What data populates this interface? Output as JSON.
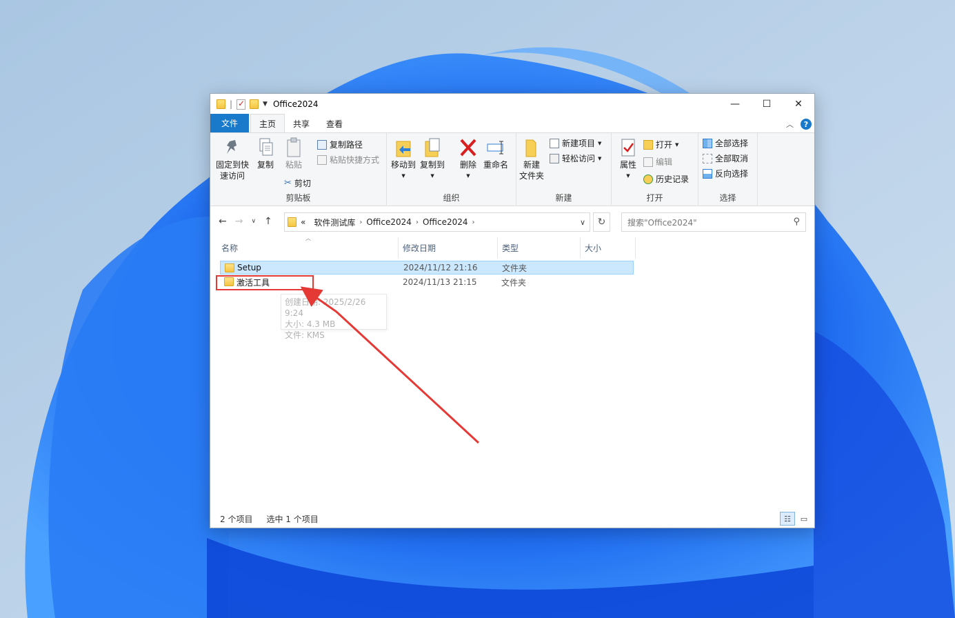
{
  "colors": {
    "accent": "#1979ca",
    "highlight": "#e53935",
    "selection": "#cce8ff"
  },
  "window": {
    "title": "Office2024",
    "controls": {
      "minimize": "—",
      "maximize": "☐",
      "close": "✕"
    }
  },
  "tabs": {
    "file": "文件",
    "home": "主页",
    "share": "共享",
    "view": "查看"
  },
  "ribbon": {
    "clipboard": {
      "label": "剪贴板",
      "pin_line1": "固定到快",
      "pin_line2": "速访问",
      "copy": "复制",
      "paste": "粘贴",
      "copy_path": "复制路径",
      "paste_shortcut": "粘贴快捷方式",
      "cut": "剪切"
    },
    "organize": {
      "label": "组织",
      "move_to": "移动到",
      "copy_to": "复制到",
      "delete": "删除",
      "rename": "重命名"
    },
    "new": {
      "label": "新建",
      "new_folder_line1": "新建",
      "new_folder_line2": "文件夹",
      "new_item": "新建项目",
      "easy_access": "轻松访问"
    },
    "open": {
      "label": "打开",
      "properties": "属性",
      "open": "打开",
      "edit": "编辑",
      "history": "历史记录"
    },
    "select": {
      "label": "选择",
      "select_all": "全部选择",
      "select_none": "全部取消",
      "invert": "反向选择"
    }
  },
  "address": {
    "prefix": "«",
    "crumbs": [
      "软件测试库",
      "Office2024",
      "Office2024"
    ],
    "search_placeholder": "搜索\"Office2024\""
  },
  "columns": {
    "name": "名称",
    "modified": "修改日期",
    "type": "类型",
    "size": "大小"
  },
  "files": [
    {
      "name": "Setup",
      "modified": "2024/11/12 21:16",
      "type": "文件夹"
    },
    {
      "name": "激活工具",
      "modified": "2024/11/13 21:15",
      "type": "文件夹"
    }
  ],
  "tooltip": {
    "line1": "创建日期: 2025/2/26 9:24",
    "line2": "大小: 4.3 MB",
    "line3": "文件: KMS"
  },
  "status": {
    "count": "2 个项目",
    "selected": "选中 1 个项目"
  }
}
